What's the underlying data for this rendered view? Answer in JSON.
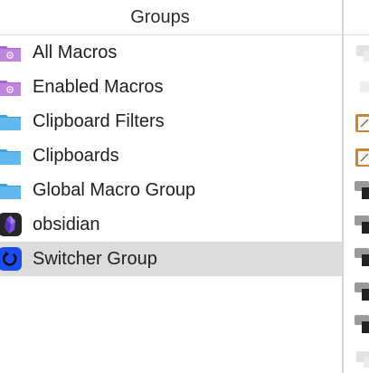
{
  "groups_header": {
    "label": "Groups"
  },
  "groups": [
    {
      "label": "All Macros",
      "icon": "smart-folder-purple-icon",
      "selected": false
    },
    {
      "label": "Enabled Macros",
      "icon": "smart-folder-purple-icon",
      "selected": false
    },
    {
      "label": "Clipboard Filters",
      "icon": "folder-blue-icon",
      "selected": false
    },
    {
      "label": "Clipboards",
      "icon": "folder-blue-icon",
      "selected": false
    },
    {
      "label": "Global Macro Group",
      "icon": "folder-blue-icon",
      "selected": false
    },
    {
      "label": "obsidian",
      "icon": "obsidian-app-icon",
      "selected": false
    },
    {
      "label": "Switcher Group",
      "icon": "switcher-group-icon",
      "selected": true
    }
  ],
  "colors": {
    "smart_folder": "#b77ad6",
    "folder": "#58b3ea",
    "selection": "#dcdcdc",
    "switcher": "#1a4cf5",
    "obsidian": "#2b2b2b"
  }
}
